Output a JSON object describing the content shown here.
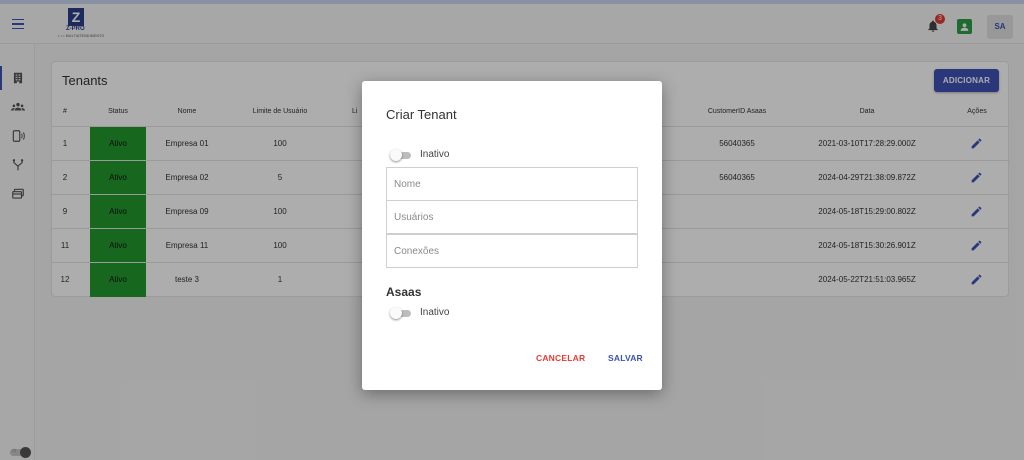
{
  "app": {
    "logo_letter": "Z",
    "logo_name": "Z-PRO",
    "logo_tagline": "• • • MULTIATENDIMENTO",
    "notification_count": "3",
    "avatar_initials": "SA"
  },
  "sidebar": {
    "items": [
      {
        "icon": "building-icon",
        "active": true
      },
      {
        "icon": "users-group-icon",
        "active": false
      },
      {
        "icon": "phone-connection-icon",
        "active": false
      },
      {
        "icon": "branch-icon",
        "active": false
      },
      {
        "icon": "cards-icon",
        "active": false
      }
    ]
  },
  "page": {
    "title": "Tenants",
    "add_label": "ADICIONAR"
  },
  "table": {
    "headers": {
      "id": "#",
      "status": "Status",
      "name": "Nome",
      "user_limit": "Limite de Usuário",
      "partial": "Li",
      "customer_id": "CustomerID Asaas",
      "date": "Data",
      "actions": "Ações"
    },
    "rows": [
      {
        "id": "1",
        "status": "Ativo",
        "name": "Empresa 01",
        "user_limit": "100",
        "customer_id": "56040365",
        "date": "2021-03-10T17:28:29.000Z"
      },
      {
        "id": "2",
        "status": "Ativo",
        "name": "Empresa 02",
        "user_limit": "5",
        "customer_id": "56040365",
        "date": "2024-04-29T21:38:09.872Z"
      },
      {
        "id": "9",
        "status": "Ativo",
        "name": "Empresa 09",
        "user_limit": "100",
        "customer_id": "",
        "date": "2024-05-18T15:29:00.802Z"
      },
      {
        "id": "11",
        "status": "Ativo",
        "name": "Empresa 11",
        "user_limit": "100",
        "customer_id": "",
        "date": "2024-05-18T15:30:26.901Z"
      },
      {
        "id": "12",
        "status": "Ativo",
        "name": "teste 3",
        "user_limit": "1",
        "customer_id": "",
        "date": "2024-05-22T21:51:03.965Z"
      }
    ]
  },
  "modal": {
    "title": "Criar Tenant",
    "status_toggle_label": "Inativo",
    "fields": {
      "name_placeholder": "Nome",
      "users_placeholder": "Usuários",
      "connections_placeholder": "Conexões"
    },
    "asaas_title": "Asaas",
    "asaas_toggle_label": "Inativo",
    "cancel_label": "CANCELAR",
    "save_label": "SALVAR"
  },
  "colors": {
    "primary": "#3f51b5",
    "status_active": "#22992f",
    "danger": "#e53935",
    "overlay": "rgba(0,0,0,0.32)"
  }
}
